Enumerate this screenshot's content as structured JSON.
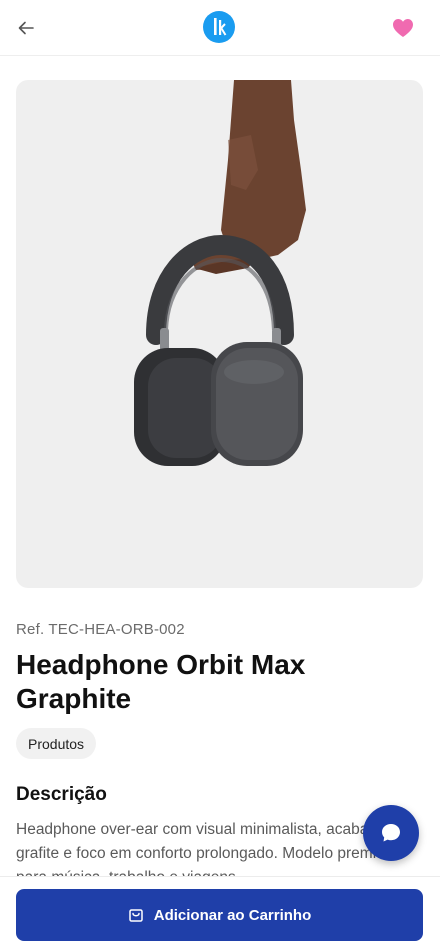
{
  "header": {
    "back_icon": "arrow-left-icon",
    "logo_text": "lk",
    "logo_color": "#1a9cf0",
    "favorite_icon": "heart-icon",
    "favorite_color": "#f06ab0"
  },
  "product": {
    "image_alt": "Headphone Orbit Max Graphite",
    "reference": "Ref. TEC-HEA-ORB-002",
    "name": "Headphone Orbit Max Graphite",
    "category": "Produtos",
    "description_heading": "Descrição",
    "description": "Headphone over-ear com visual minimalista, acabamento grafite e foco em conforto prolongado. Modelo premium para música, trabalho e viagens."
  },
  "chat": {
    "icon": "chat-bubble-icon"
  },
  "actions": {
    "add_to_cart_label": "Adicionar ao Carrinho",
    "add_to_cart_icon": "shopping-bag-icon",
    "primary_color": "#1f3fa9"
  }
}
